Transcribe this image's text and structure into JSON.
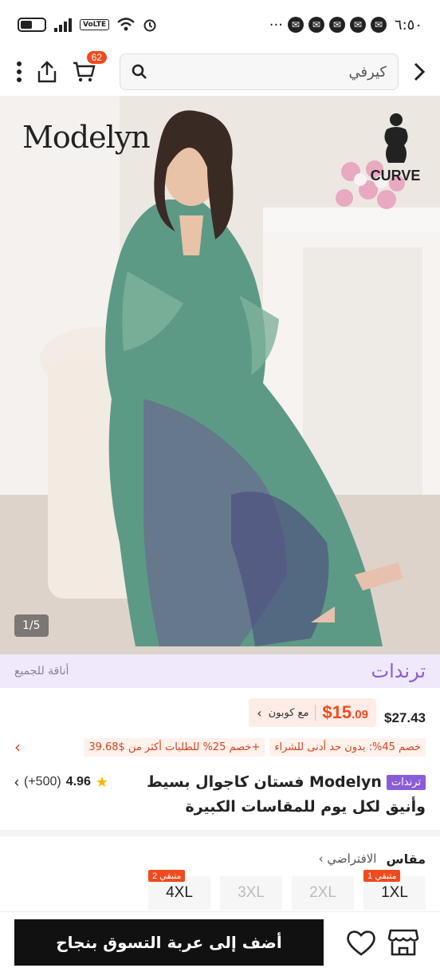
{
  "status_bar": {
    "time": "٦:٥٠",
    "network": "VoLTE",
    "ellipsis": "···"
  },
  "top_bar": {
    "search_text": "كيرفي",
    "cart_count": "62"
  },
  "hero": {
    "brand_logo": "Modelyn",
    "curve_label": "CURVE",
    "pager": "1/5"
  },
  "trend_bar": {
    "title": "ترندات",
    "subtitle": "أناقة للجميع"
  },
  "price": {
    "old_price": "$27.43",
    "sale_price_main": "$15",
    "sale_price_cents": ".09",
    "coupon_label": "مع كوبون"
  },
  "promos": {
    "discount": "خصم 45%: بدون حد أدنى للشراء",
    "order_discount": "خصم 25% للطلبات أكثر من $39.68+"
  },
  "product": {
    "tag": "ترندات",
    "title_line1": "Modelyn فستان كاجوال بسيط",
    "title_line2": "وأنيق لكل يوم للمقاسات الكبيرة",
    "rating": "4.96",
    "review_count": "(+500)"
  },
  "size_section": {
    "title": "مقاس",
    "default_label": "الافتراضي",
    "options": [
      {
        "label": "1XL",
        "left_badge": "متبقي 1",
        "available": true
      },
      {
        "label": "2XL",
        "left_badge": "",
        "available": false
      },
      {
        "label": "3XL",
        "left_badge": "",
        "available": false
      },
      {
        "label": "4XL",
        "left_badge": "متبقي 2",
        "available": true
      }
    ]
  },
  "bottom_bar": {
    "add_to_cart": "أضف إلى عربة التسوق بنجاح"
  }
}
